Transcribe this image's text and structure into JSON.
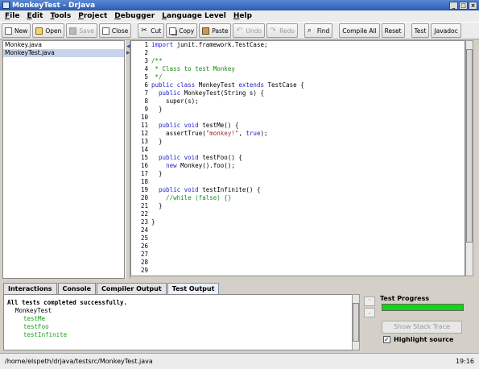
{
  "window": {
    "title": "MonkeyTest - DrJava"
  },
  "menu": [
    "File",
    "Edit",
    "Tools",
    "Project",
    "Debugger",
    "Language Level",
    "Help"
  ],
  "toolbar": {
    "new": "New",
    "open": "Open",
    "save": "Save",
    "close": "Close",
    "cut": "Cut",
    "copy": "Copy",
    "paste": "Paste",
    "undo": "Undo",
    "redo": "Redo",
    "find": "Find",
    "compile_all": "Compile All",
    "reset": "Reset",
    "test": "Test",
    "javadoc": "Javadoc"
  },
  "files": [
    "Monkey.java",
    "MonkeyTest.java"
  ],
  "editor": {
    "lines": [
      {
        "n": "1",
        "parts": [
          [
            "kw",
            "import "
          ],
          [
            "plain",
            "junit.framework.TestCase;"
          ]
        ]
      },
      {
        "n": "2",
        "parts": []
      },
      {
        "n": "3",
        "parts": [
          [
            "cm",
            "/**"
          ]
        ]
      },
      {
        "n": "4",
        "parts": [
          [
            "cm",
            " * Class to test Monkey"
          ]
        ]
      },
      {
        "n": "5",
        "parts": [
          [
            "cm",
            " */"
          ]
        ]
      },
      {
        "n": "6",
        "parts": [
          [
            "kw",
            "public class "
          ],
          [
            "plain",
            "MonkeyTest "
          ],
          [
            "kw",
            "extends "
          ],
          [
            "plain",
            "TestCase {"
          ]
        ]
      },
      {
        "n": "7",
        "parts": [
          [
            "plain",
            "  "
          ],
          [
            "kw",
            "public "
          ],
          [
            "plain",
            "MonkeyTest(String s) {"
          ]
        ]
      },
      {
        "n": "8",
        "parts": [
          [
            "plain",
            "    super(s);"
          ]
        ]
      },
      {
        "n": "9",
        "parts": [
          [
            "plain",
            "  }"
          ]
        ]
      },
      {
        "n": "10",
        "parts": []
      },
      {
        "n": "11",
        "parts": [
          [
            "plain",
            "  "
          ],
          [
            "kw",
            "public void "
          ],
          [
            "plain",
            "testMe() {"
          ]
        ]
      },
      {
        "n": "12",
        "parts": [
          [
            "plain",
            "    assertTrue("
          ],
          [
            "st",
            "\"monkey!\""
          ],
          [
            "plain",
            ", "
          ],
          [
            "kw",
            "true"
          ],
          [
            "plain",
            ");"
          ]
        ]
      },
      {
        "n": "13",
        "parts": [
          [
            "plain",
            "  }"
          ]
        ]
      },
      {
        "n": "14",
        "parts": []
      },
      {
        "n": "15",
        "parts": [
          [
            "plain",
            "  "
          ],
          [
            "kw",
            "public void "
          ],
          [
            "plain",
            "testFoo() {"
          ]
        ]
      },
      {
        "n": "16",
        "parts": [
          [
            "plain",
            "    "
          ],
          [
            "kw",
            "new "
          ],
          [
            "plain",
            "Monkey().foo();"
          ]
        ]
      },
      {
        "n": "17",
        "parts": [
          [
            "plain",
            "  }"
          ]
        ]
      },
      {
        "n": "18",
        "parts": []
      },
      {
        "n": "19",
        "parts": [
          [
            "plain",
            "  "
          ],
          [
            "kw",
            "public void "
          ],
          [
            "plain",
            "testInfinite() {"
          ]
        ]
      },
      {
        "n": "20",
        "parts": [
          [
            "cm",
            "    //while (false) {}"
          ]
        ]
      },
      {
        "n": "21",
        "parts": [
          [
            "plain",
            "  }"
          ]
        ]
      },
      {
        "n": "22",
        "parts": []
      },
      {
        "n": "23",
        "parts": [
          [
            "plain",
            "}"
          ]
        ]
      },
      {
        "n": "24",
        "parts": []
      },
      {
        "n": "25",
        "parts": []
      },
      {
        "n": "26",
        "parts": []
      },
      {
        "n": "27",
        "parts": []
      },
      {
        "n": "28",
        "parts": []
      },
      {
        "n": "29",
        "parts": []
      }
    ]
  },
  "tabs": [
    "Interactions",
    "Console",
    "Compiler Output",
    "Test Output"
  ],
  "test_output": {
    "summary": "All tests completed successfully.",
    "suite": "MonkeyTest",
    "tests": [
      "testMe",
      "testFoo",
      "testInfinite"
    ]
  },
  "test_panel": {
    "progress_label": "Test Progress",
    "progress_fraction": 1.0,
    "stack_trace_button": "Show Stack Trace",
    "highlight_label": "Highlight source",
    "highlight_checked": true
  },
  "status": {
    "path": "/home/elspeth/drjava/testsrc/MonkeyTest.java",
    "position": "19:16"
  },
  "colors": {
    "progress_fill": "#14d214",
    "keyword": "#2222cc",
    "comment": "#1a8a1a",
    "string": "#a52a2a"
  }
}
